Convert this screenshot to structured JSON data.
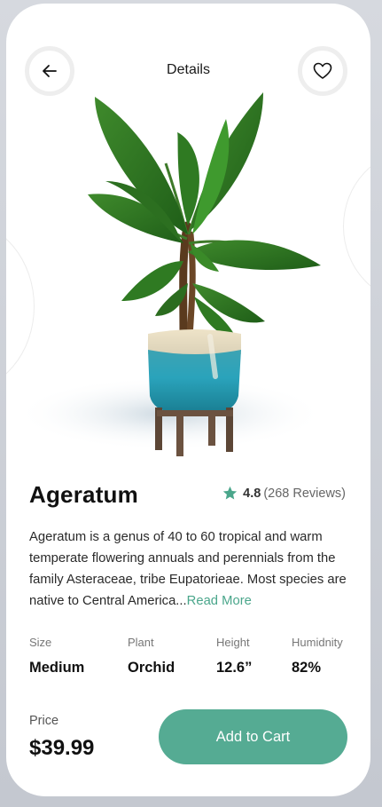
{
  "header": {
    "title": "Details",
    "back_icon": "arrow-left-icon",
    "favorite_icon": "heart-icon"
  },
  "product": {
    "name": "Ageratum",
    "rating": "4.8",
    "reviews": "(268 Reviews)",
    "description": "Ageratum is a genus of 40 to 60 tropical and warm temperate flowering annuals and perennials from the family Asteraceae, tribe Eupatorieae. Most species are native to Central America...",
    "read_more": "Read More"
  },
  "specs": [
    {
      "label": "Size",
      "value": "Medium"
    },
    {
      "label": "Plant",
      "value": "Orchid"
    },
    {
      "label": "Height",
      "value": "12.6”"
    },
    {
      "label": "Humidnity",
      "value": "82%"
    }
  ],
  "price": {
    "label": "Price",
    "value": "$39.99"
  },
  "actions": {
    "add_to_cart": "Add to Cart"
  },
  "colors": {
    "accent": "#55ab93",
    "star": "#4aa68b"
  }
}
